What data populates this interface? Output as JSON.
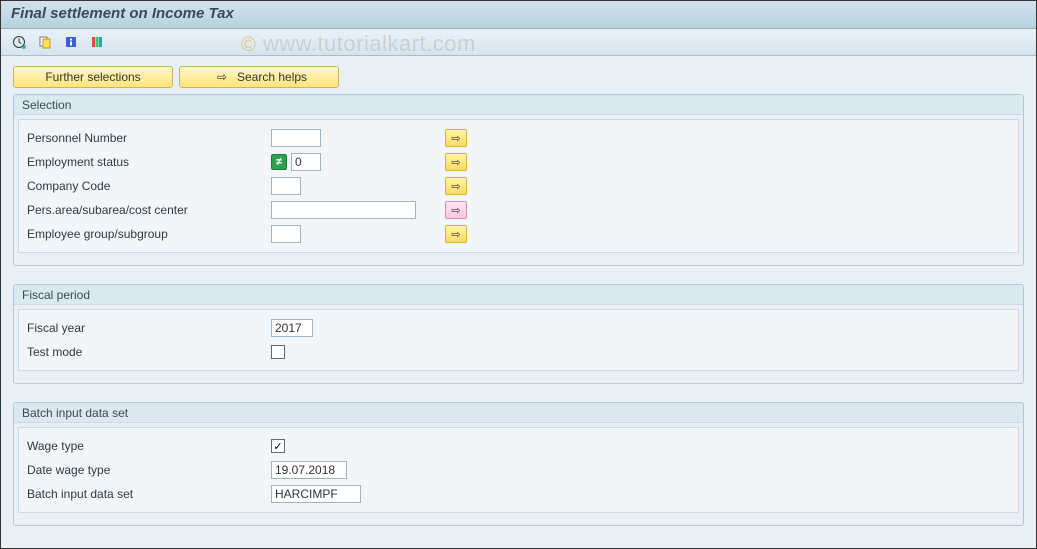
{
  "title": "Final settlement on Income Tax",
  "watermark": "www.tutorialkart.com",
  "toolbar": {
    "execute_tip": "Execute",
    "variant_tip": "Get Variant",
    "info_tip": "Information",
    "layout_tip": "Layout"
  },
  "buttons": {
    "further_selections": "Further selections",
    "search_helps": "Search helps"
  },
  "groups": {
    "selection": {
      "title": "Selection",
      "personnel_number": {
        "label": "Personnel Number",
        "value": ""
      },
      "employment_status": {
        "label": "Employment status",
        "value": "0",
        "not_equal": "≠"
      },
      "company_code": {
        "label": "Company Code",
        "value": ""
      },
      "pers_area": {
        "label": "Pers.area/subarea/cost center",
        "value": ""
      },
      "employee_group": {
        "label": "Employee group/subgroup",
        "value": ""
      }
    },
    "fiscal": {
      "title": "Fiscal period",
      "fiscal_year": {
        "label": "Fiscal year",
        "value": "2017"
      },
      "test_mode": {
        "label": "Test mode",
        "checked": false
      }
    },
    "batch": {
      "title": "Batch input data set",
      "wage_type": {
        "label": "Wage type",
        "checked": true
      },
      "date_wage_type": {
        "label": "Date wage type",
        "value": "19.07.2018"
      },
      "batch_input": {
        "label": "Batch input data set",
        "value": "HARCIMPF"
      }
    }
  },
  "arrow_glyph": "⇨",
  "check_glyph": "✓"
}
